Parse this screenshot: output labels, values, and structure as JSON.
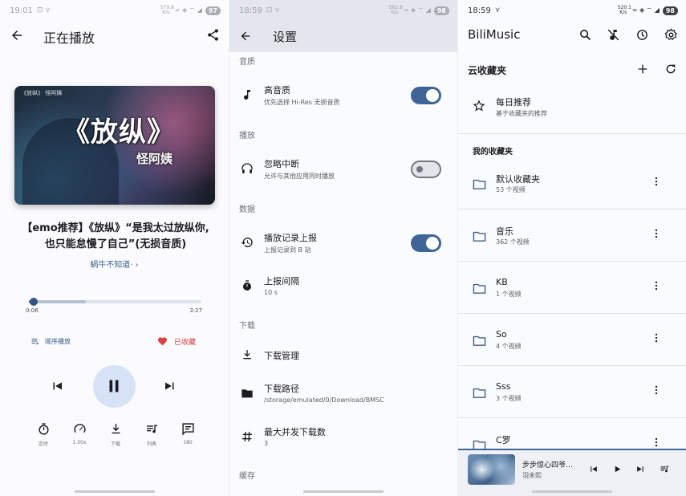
{
  "player": {
    "status": {
      "time": "19:01",
      "note": "⊡ ⋎",
      "net": "579.8\nK/s",
      "icons": "∞ ◈ ⌔ ◢",
      "battery": "97"
    },
    "title": "正在播放",
    "song_title": "【emo推荐】《放纵》“是我太过放纵你,也只能怠慢了自己”(无损音质)",
    "artist": "蜗牛不知道· ›",
    "cover": {
      "logo": "《放纵》 怪阿姨",
      "title": "《放纵》",
      "artist": "怪阿姨"
    },
    "position": "0:06",
    "duration": "3:27",
    "progress_fraction": 0.029,
    "buffered_fraction": 0.33,
    "mode_label": "顺序播放",
    "favorite_label": "已收藏",
    "tools": [
      {
        "icon": "timer-icon",
        "label": "定时"
      },
      {
        "icon": "speed-icon",
        "label": "1.00x"
      },
      {
        "icon": "download-icon",
        "label": "下载"
      },
      {
        "icon": "queue-icon",
        "label": "列表"
      },
      {
        "icon": "comment-icon",
        "label": "180"
      }
    ]
  },
  "settings": {
    "status": {
      "time": "18:59",
      "note": "⊡ ⋎",
      "net": "562.8\nK/s",
      "icons": "∞ ◈ ⌔ ◢",
      "battery": "98"
    },
    "title": "设置",
    "sections": {
      "quality": "音质",
      "playback": "播放",
      "data": "数据",
      "download": "下载",
      "cache": "缓存"
    },
    "items": {
      "hires": {
        "title": "高音质",
        "subtitle": "优先选择 Hi-Res 无损音质",
        "on": true
      },
      "ignore_interrupt": {
        "title": "忽略中断",
        "subtitle": "允许与其他应用同时播放",
        "on": false
      },
      "report": {
        "title": "播放记录上报",
        "subtitle": "上报记录到 B 站",
        "on": true
      },
      "interval": {
        "title": "上报间隔",
        "subtitle": "10 s"
      },
      "download_mgr": {
        "title": "下载管理"
      },
      "download_path": {
        "title": "下载路径",
        "subtitle": "/storage/emulated/0/Download/BMSC"
      },
      "max_concurrent": {
        "title": "最大并发下载数",
        "subtitle": "3"
      }
    }
  },
  "library": {
    "status": {
      "time": "18:59",
      "note": "⋎",
      "net": "520.1\nK/s",
      "icons": "∞ ◈ ⌔ ◢",
      "battery": "98"
    },
    "app_title": "BiliMusic",
    "cloud_header": "云收藏夹",
    "daily": {
      "title": "每日推荐",
      "subtitle": "基于收藏夹的推荐"
    },
    "my_header": "我的收藏夹",
    "folders": [
      {
        "name": "默认收藏夹",
        "count": "53 个视频"
      },
      {
        "name": "音乐",
        "count": "362 个视频"
      },
      {
        "name": "KB",
        "count": "1 个视频"
      },
      {
        "name": "So",
        "count": "4 个视频"
      },
      {
        "name": "Sss",
        "count": "3 个视频"
      },
      {
        "name": "C罗",
        "count": ""
      }
    ],
    "mini_player": {
      "title": "步步惊心四爷…",
      "artist": "羽未熙"
    }
  }
}
